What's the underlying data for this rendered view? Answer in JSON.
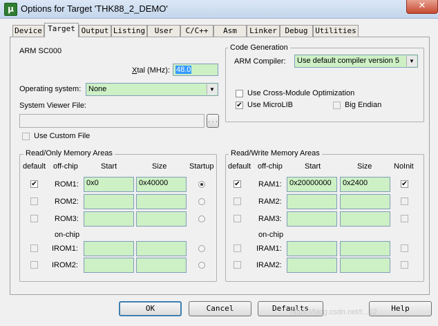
{
  "window": {
    "title": "Options for Target 'THK88_2_DEMO'",
    "close": "✕",
    "app_icon": "μ"
  },
  "tabs": [
    "Device",
    "Target",
    "Output",
    "Listing",
    "User",
    "C/C++",
    "Asm",
    "Linker",
    "Debug",
    "Utilities"
  ],
  "active_tab": "Target",
  "target": {
    "device": "ARM SC000",
    "xtal_label": "Xtal (MHz):",
    "xtal_value": "48.0",
    "os_label": "Operating system:",
    "os_value": "None",
    "svf_label": "System Viewer File:",
    "svf_value": "",
    "browse_label": "...",
    "custom_file_label": "Use Custom File"
  },
  "codegen": {
    "legend": "Code Generation",
    "compiler_label": "ARM Compiler:",
    "compiler_value": "Use default compiler version 5",
    "cross_module_label": "Use Cross-Module Optimization",
    "microlib_label": "Use MicroLIB",
    "big_endian_label": "Big Endian",
    "cross_module_checked": false,
    "microlib_checked": true,
    "big_endian_checked": false
  },
  "ro_mem": {
    "legend": "Read/Only Memory Areas",
    "headers": {
      "default": "default",
      "offchip": "off-chip",
      "start": "Start",
      "size": "Size",
      "startup": "Startup"
    },
    "onchip_label": "on-chip",
    "rows": [
      {
        "name": "ROM1:",
        "start": "0x0",
        "size": "0x40000",
        "default": true,
        "startup": true
      },
      {
        "name": "ROM2:",
        "start": "",
        "size": "",
        "default": false,
        "startup": false
      },
      {
        "name": "ROM3:",
        "start": "",
        "size": "",
        "default": false,
        "startup": false
      },
      {
        "name": "IROM1:",
        "start": "",
        "size": "",
        "default": false,
        "startup": false
      },
      {
        "name": "IROM2:",
        "start": "",
        "size": "",
        "default": false,
        "startup": false
      }
    ]
  },
  "rw_mem": {
    "legend": "Read/Write Memory Areas",
    "headers": {
      "default": "default",
      "offchip": "off-chip",
      "start": "Start",
      "size": "Size",
      "noinit": "NoInit"
    },
    "onchip_label": "on-chip",
    "rows": [
      {
        "name": "RAM1:",
        "start": "0x20000000",
        "size": "0x2400",
        "default": true,
        "noinit": true
      },
      {
        "name": "RAM2:",
        "start": "",
        "size": "",
        "default": false,
        "noinit": false
      },
      {
        "name": "RAM3:",
        "start": "",
        "size": "",
        "default": false,
        "noinit": false
      },
      {
        "name": "IRAM1:",
        "start": "",
        "size": "",
        "default": false,
        "noinit": false
      },
      {
        "name": "IRAM2:",
        "start": "",
        "size": "",
        "default": false,
        "noinit": false
      }
    ]
  },
  "buttons": {
    "ok": "OK",
    "cancel": "Cancel",
    "defaults": "Defaults",
    "help": "Help"
  },
  "watermark": "https://blog.csdn.net/t...12"
}
